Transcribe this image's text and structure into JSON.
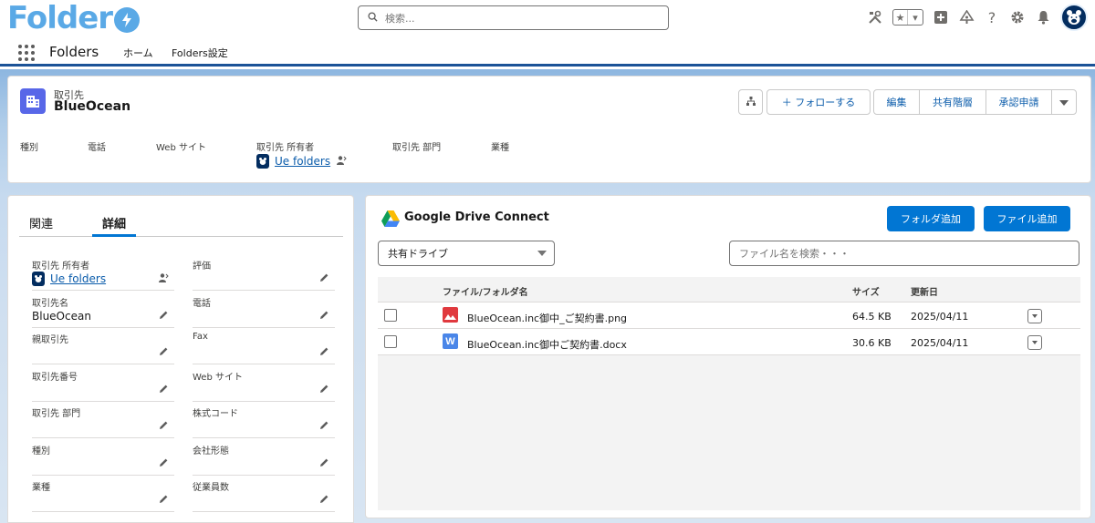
{
  "brand": {
    "logo_text": "Folder",
    "accent": "#5aa9e6",
    "primary_button": "#0176d3",
    "nav_border": "#1b5297"
  },
  "global_header": {
    "search_placeholder": "検索...",
    "icons": [
      "setup-tools-icon",
      "favorites-star-icon",
      "favorites-dropdown-icon",
      "global-add-icon",
      "trailhead-icon",
      "help-icon",
      "settings-gear-icon",
      "notifications-bell-icon",
      "user-avatar-icon"
    ]
  },
  "nav": {
    "app_name": "Folders",
    "items": [
      {
        "label": "ホーム"
      },
      {
        "label": "Folders設定"
      }
    ]
  },
  "record": {
    "object_label": "取引先",
    "name": "BlueOcean",
    "actions": {
      "hierarchy_icon": "hierarchy-icon",
      "follow": "＋ フォローする",
      "edit": "編集",
      "share_hierarchy": "共有階層",
      "approval": "承認申請",
      "more_icon": "chevron-down-icon"
    },
    "highlights": [
      {
        "label": "種別"
      },
      {
        "label": "電話"
      },
      {
        "label": "Web サイト"
      },
      {
        "label": "取引先 所有者",
        "value": "Ue folders"
      },
      {
        "label": "取引先 部門"
      },
      {
        "label": "業種"
      }
    ]
  },
  "details": {
    "tabs": [
      {
        "label": "関連",
        "active": false
      },
      {
        "label": "詳細",
        "active": true
      }
    ],
    "left_fields": [
      {
        "label": "取引先 所有者",
        "value": "Ue folders",
        "is_link": true
      },
      {
        "label": "取引先名",
        "value": "BlueOcean"
      },
      {
        "label": "親取引先",
        "value": ""
      },
      {
        "label": "取引先番号",
        "value": ""
      },
      {
        "label": "取引先 部門",
        "value": ""
      },
      {
        "label": "種別",
        "value": ""
      },
      {
        "label": "業種",
        "value": ""
      }
    ],
    "right_fields": [
      {
        "label": "評価",
        "value": ""
      },
      {
        "label": "電話",
        "value": ""
      },
      {
        "label": "Fax",
        "value": ""
      },
      {
        "label": "Web サイト",
        "value": ""
      },
      {
        "label": "株式コード",
        "value": ""
      },
      {
        "label": "会社形態",
        "value": ""
      },
      {
        "label": "従業員数",
        "value": ""
      }
    ]
  },
  "drive": {
    "title": "Google Drive Connect",
    "add_folder": "フォルダ追加",
    "add_file": "ファイル追加",
    "drive_select": "共有ドライブ",
    "file_search_placeholder": "ファイル名を検索・・・",
    "columns": {
      "name": "ファイル/フォルダ名",
      "size": "サイズ",
      "updated": "更新日"
    },
    "files": [
      {
        "name": "BlueOcean.inc御中_ご契約書.png",
        "size": "64.5 KB",
        "updated": "2025/04/11",
        "type_icon": "image-file-icon",
        "icon_color": "#e0393e"
      },
      {
        "name": "BlueOcean.inc御中ご契約書.docx",
        "size": "30.6 KB",
        "updated": "2025/04/11",
        "type_icon": "word-file-icon",
        "icon_color": "#4a86e8",
        "icon_letter": "W"
      }
    ]
  }
}
